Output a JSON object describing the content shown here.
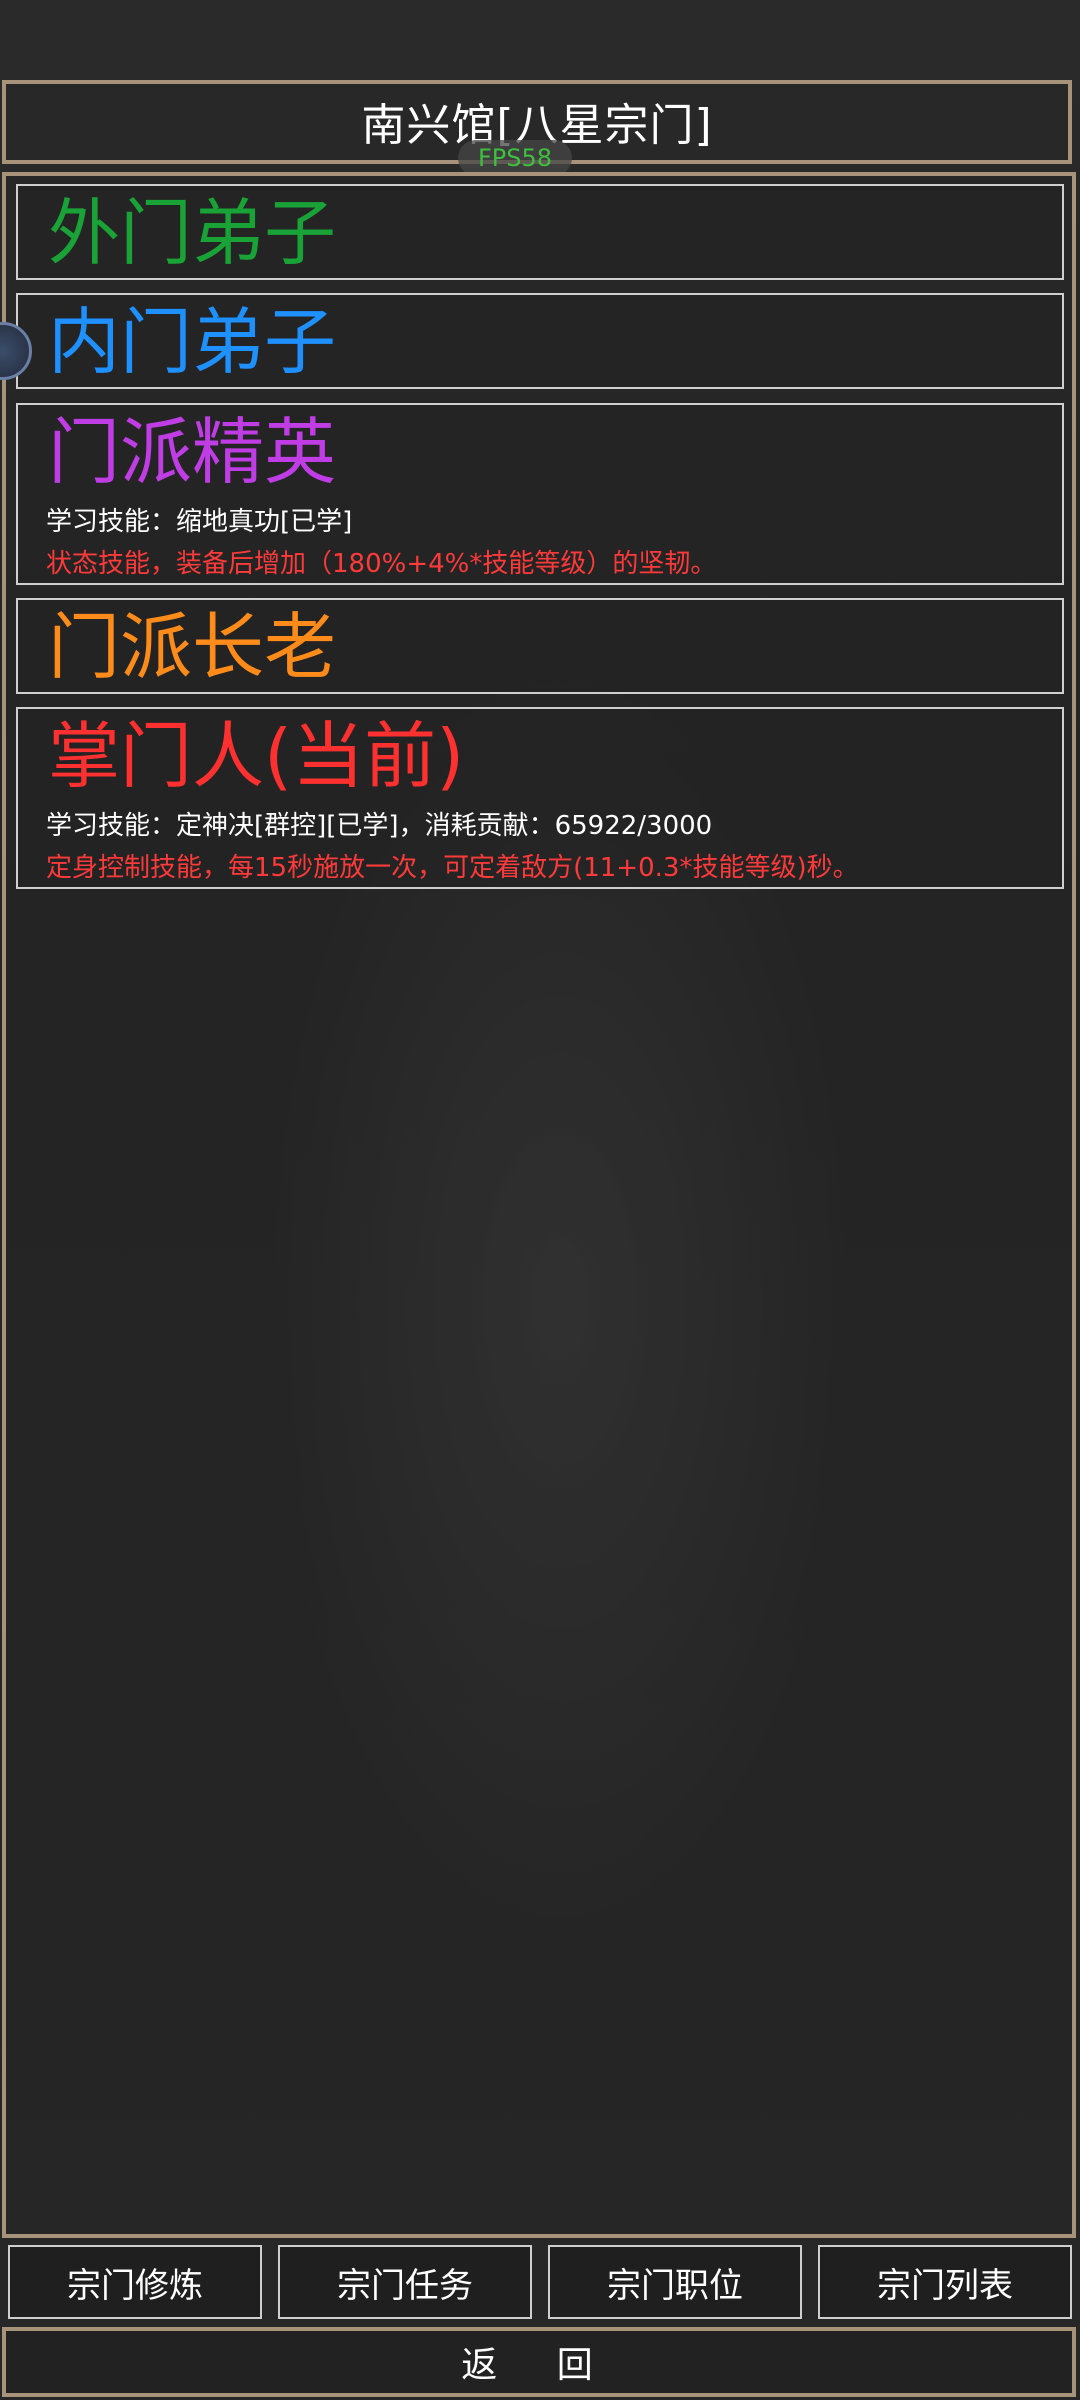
{
  "header": {
    "title": "南兴馆[八星宗门]",
    "fps": "FPS58"
  },
  "ranks": [
    {
      "name": "外门弟子",
      "color": "#19a337"
    },
    {
      "name": "内门弟子",
      "color": "#1e90ff"
    },
    {
      "name": "门派精英",
      "color": "#c03de6",
      "skill": "学习技能：缩地真功[已学]",
      "desc": "状态技能，装备后增加（180%+4%*技能等级）的坚韧。"
    },
    {
      "name": "门派长老",
      "color": "#ff8c1a"
    },
    {
      "name": "掌门人(当前)",
      "color": "#ff3030",
      "skill": "学习技能：定神决[群控][已学]，消耗贡献：65922/3000",
      "desc": "定身控制技能，每15秒施放一次，可定着敌方(11+0.3*技能等级)秒。"
    }
  ],
  "bottom_nav": {
    "cultivate": "宗门修炼",
    "tasks": "宗门任务",
    "positions": "宗门职位",
    "list": "宗门列表"
  },
  "back": "返 回"
}
